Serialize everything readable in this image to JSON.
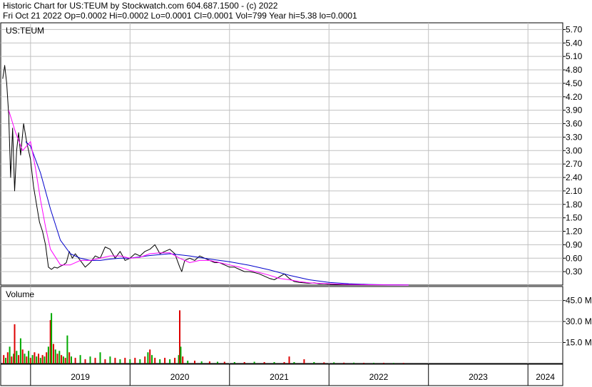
{
  "header": {
    "line1": "Historic Chart for US:TEUM by Stockwatch.com 604.687.1500 - (c) 2022",
    "line2": "Fri Oct 21 2022   Op=0.0002   Hi=0.0002   Lo=0.0001   Cl=0.0001   Vol=799   Year hi=5.38   lo=0.0001"
  },
  "colors": {
    "price": "#000000",
    "ma_fast": "#ff00ff",
    "ma_slow": "#0000cc",
    "vol_up": "#00aa00",
    "vol_down": "#dd0000",
    "grid": "#c0c0c0"
  },
  "chart_data": [
    {
      "type": "line",
      "title": "US:TEUM",
      "ylim": [
        0,
        5.85
      ],
      "yticks": [
        "5.70",
        "5.40",
        "5.10",
        "4.80",
        "4.50",
        "4.20",
        "3.90",
        "3.60",
        "3.30",
        "3.00",
        "2.70",
        "2.40",
        "2.10",
        "1.80",
        "1.50",
        "1.20",
        "0.90",
        "0.60",
        "0.30"
      ],
      "yticks_values": [
        5.7,
        5.4,
        5.1,
        4.8,
        4.5,
        4.2,
        3.9,
        3.6,
        3.3,
        3.0,
        2.7,
        2.4,
        2.1,
        1.8,
        1.5,
        1.2,
        0.9,
        0.6,
        0.3
      ],
      "x_years": [
        "2019",
        "2020",
        "2021",
        "2022",
        "2023",
        "2024"
      ],
      "x_year_starts": [
        2019.0,
        2020.0,
        2021.0,
        2022.0,
        2023.0,
        2024.0
      ],
      "x_range": [
        2018.7,
        2024.35
      ],
      "series": [
        {
          "key": "price",
          "x": [
            2018.72,
            2018.74,
            2018.76,
            2018.78,
            2018.8,
            2018.82,
            2018.84,
            2018.86,
            2018.88,
            2018.9,
            2018.93,
            2018.96,
            2019.0,
            2019.03,
            2019.06,
            2019.09,
            2019.12,
            2019.15,
            2019.18,
            2019.21,
            2019.24,
            2019.27,
            2019.3,
            2019.33,
            2019.36,
            2019.39,
            2019.42,
            2019.45,
            2019.5,
            2019.55,
            2019.6,
            2019.65,
            2019.7,
            2019.75,
            2019.8,
            2019.85,
            2019.9,
            2019.95,
            2020.0,
            2020.05,
            2020.1,
            2020.15,
            2020.2,
            2020.25,
            2020.3,
            2020.35,
            2020.4,
            2020.45,
            2020.5,
            2020.52,
            2020.55,
            2020.6,
            2020.65,
            2020.7,
            2020.75,
            2020.8,
            2020.85,
            2020.9,
            2020.95,
            2021.0,
            2021.05,
            2021.1,
            2021.15,
            2021.2,
            2021.25,
            2021.3,
            2021.35,
            2021.4,
            2021.45,
            2021.5,
            2021.55,
            2021.6,
            2021.65,
            2021.7,
            2021.75,
            2021.8,
            2021.85,
            2021.9,
            2021.95,
            2022.0,
            2022.1,
            2022.2,
            2022.3,
            2022.4,
            2022.5,
            2022.6,
            2022.7,
            2022.8
          ],
          "values": [
            4.6,
            4.9,
            4.5,
            3.8,
            2.4,
            3.5,
            2.1,
            3.0,
            3.4,
            2.9,
            3.6,
            3.2,
            2.8,
            2.2,
            1.8,
            1.4,
            1.2,
            0.9,
            0.4,
            0.35,
            0.4,
            0.38,
            0.42,
            0.45,
            0.5,
            0.75,
            0.6,
            0.7,
            0.55,
            0.4,
            0.5,
            0.65,
            0.6,
            0.85,
            0.8,
            0.6,
            0.75,
            0.55,
            0.6,
            0.7,
            0.65,
            0.75,
            0.8,
            0.9,
            0.7,
            0.75,
            0.8,
            0.7,
            0.4,
            0.3,
            0.55,
            0.6,
            0.55,
            0.65,
            0.6,
            0.55,
            0.5,
            0.5,
            0.45,
            0.4,
            0.4,
            0.35,
            0.3,
            0.3,
            0.28,
            0.25,
            0.2,
            0.15,
            0.12,
            0.18,
            0.25,
            0.15,
            0.08,
            0.06,
            0.05,
            0.04,
            0.05,
            0.03,
            0.03,
            0.02,
            0.015,
            0.012,
            0.01,
            0.008,
            0.006,
            0.004,
            0.003,
            0.002
          ]
        },
        {
          "key": "ma_fast",
          "x": [
            2018.78,
            2018.85,
            2018.92,
            2019.0,
            2019.05,
            2019.1,
            2019.15,
            2019.2,
            2019.3,
            2019.4,
            2019.5,
            2019.6,
            2019.7,
            2019.8,
            2019.9,
            2020.0,
            2020.1,
            2020.2,
            2020.3,
            2020.4,
            2020.5,
            2020.6,
            2020.7,
            2020.8,
            2020.9,
            2021.0,
            2021.1,
            2021.2,
            2021.3,
            2021.4,
            2021.5,
            2021.6,
            2021.7,
            2021.8,
            2021.9,
            2022.0,
            2022.2,
            2022.4,
            2022.6,
            2022.8
          ],
          "values": [
            3.9,
            3.4,
            3.0,
            3.2,
            2.6,
            1.9,
            1.3,
            0.8,
            0.45,
            0.45,
            0.55,
            0.55,
            0.6,
            0.65,
            0.65,
            0.6,
            0.62,
            0.7,
            0.72,
            0.72,
            0.6,
            0.5,
            0.55,
            0.55,
            0.5,
            0.45,
            0.4,
            0.33,
            0.28,
            0.22,
            0.15,
            0.12,
            0.08,
            0.05,
            0.04,
            0.03,
            0.015,
            0.008,
            0.004,
            0.002
          ]
        },
        {
          "key": "ma_slow",
          "x": [
            2018.95,
            2019.0,
            2019.1,
            2019.2,
            2019.3,
            2019.4,
            2019.5,
            2019.6,
            2019.7,
            2019.8,
            2019.9,
            2020.0,
            2020.2,
            2020.4,
            2020.6,
            2020.8,
            2021.0,
            2021.2,
            2021.4,
            2021.6,
            2021.8,
            2022.0,
            2022.2,
            2022.4,
            2022.6,
            2022.8
          ],
          "values": [
            3.2,
            3.1,
            2.5,
            1.7,
            1.0,
            0.7,
            0.6,
            0.55,
            0.55,
            0.58,
            0.6,
            0.6,
            0.66,
            0.7,
            0.65,
            0.58,
            0.52,
            0.44,
            0.34,
            0.22,
            0.12,
            0.06,
            0.03,
            0.015,
            0.007,
            0.003
          ]
        }
      ]
    },
    {
      "type": "bar",
      "title": "Volume",
      "ylim": [
        0,
        55
      ],
      "yticks": [
        "45.0 M",
        "30.0 M",
        "15.0 M"
      ],
      "yticks_values": [
        45,
        30,
        15
      ],
      "bars": [
        {
          "x": 2018.73,
          "v": 6,
          "up": false
        },
        {
          "x": 2018.75,
          "v": 4,
          "up": true
        },
        {
          "x": 2018.77,
          "v": 8,
          "up": false
        },
        {
          "x": 2018.79,
          "v": 12,
          "up": true
        },
        {
          "x": 2018.81,
          "v": 5,
          "up": false
        },
        {
          "x": 2018.83,
          "v": 7,
          "up": true
        },
        {
          "x": 2018.84,
          "v": 28,
          "up": false
        },
        {
          "x": 2018.86,
          "v": 9,
          "up": true
        },
        {
          "x": 2018.88,
          "v": 6,
          "up": false
        },
        {
          "x": 2018.9,
          "v": 18,
          "up": true
        },
        {
          "x": 2018.92,
          "v": 10,
          "up": false
        },
        {
          "x": 2018.94,
          "v": 7,
          "up": true
        },
        {
          "x": 2018.96,
          "v": 5,
          "up": false
        },
        {
          "x": 2018.98,
          "v": 9,
          "up": true
        },
        {
          "x": 2019.0,
          "v": 4,
          "up": false
        },
        {
          "x": 2019.02,
          "v": 6,
          "up": true
        },
        {
          "x": 2019.04,
          "v": 8,
          "up": false
        },
        {
          "x": 2019.06,
          "v": 5,
          "up": true
        },
        {
          "x": 2019.08,
          "v": 7,
          "up": false
        },
        {
          "x": 2019.1,
          "v": 4,
          "up": true
        },
        {
          "x": 2019.12,
          "v": 6,
          "up": false
        },
        {
          "x": 2019.14,
          "v": 5,
          "up": true
        },
        {
          "x": 2019.16,
          "v": 8,
          "up": false
        },
        {
          "x": 2019.18,
          "v": 12,
          "up": true
        },
        {
          "x": 2019.2,
          "v": 31,
          "up": false
        },
        {
          "x": 2019.21,
          "v": 36,
          "up": true
        },
        {
          "x": 2019.23,
          "v": 14,
          "up": false
        },
        {
          "x": 2019.25,
          "v": 10,
          "up": true
        },
        {
          "x": 2019.27,
          "v": 7,
          "up": false
        },
        {
          "x": 2019.29,
          "v": 9,
          "up": true
        },
        {
          "x": 2019.31,
          "v": 6,
          "up": false
        },
        {
          "x": 2019.33,
          "v": 5,
          "up": true
        },
        {
          "x": 2019.35,
          "v": 4,
          "up": false
        },
        {
          "x": 2019.37,
          "v": 20,
          "up": true
        },
        {
          "x": 2019.39,
          "v": 8,
          "up": false
        },
        {
          "x": 2019.41,
          "v": 5,
          "up": true
        },
        {
          "x": 2019.45,
          "v": 4,
          "up": false
        },
        {
          "x": 2019.5,
          "v": 6,
          "up": true
        },
        {
          "x": 2019.55,
          "v": 3,
          "up": false
        },
        {
          "x": 2019.6,
          "v": 5,
          "up": true
        },
        {
          "x": 2019.65,
          "v": 4,
          "up": false
        },
        {
          "x": 2019.7,
          "v": 8,
          "up": true
        },
        {
          "x": 2019.75,
          "v": 3,
          "up": false
        },
        {
          "x": 2019.8,
          "v": 5,
          "up": true
        },
        {
          "x": 2019.85,
          "v": 4,
          "up": false
        },
        {
          "x": 2019.9,
          "v": 3,
          "up": true
        },
        {
          "x": 2019.95,
          "v": 4,
          "up": false
        },
        {
          "x": 2020.0,
          "v": 3,
          "up": true
        },
        {
          "x": 2020.05,
          "v": 4,
          "up": false
        },
        {
          "x": 2020.1,
          "v": 3,
          "up": true
        },
        {
          "x": 2020.15,
          "v": 5,
          "up": false
        },
        {
          "x": 2020.18,
          "v": 8,
          "up": true
        },
        {
          "x": 2020.2,
          "v": 10,
          "up": false
        },
        {
          "x": 2020.22,
          "v": 6,
          "up": true
        },
        {
          "x": 2020.25,
          "v": 4,
          "up": false
        },
        {
          "x": 2020.3,
          "v": 3,
          "up": true
        },
        {
          "x": 2020.35,
          "v": 4,
          "up": false
        },
        {
          "x": 2020.4,
          "v": 3,
          "up": true
        },
        {
          "x": 2020.45,
          "v": 4,
          "up": false
        },
        {
          "x": 2020.49,
          "v": 6,
          "up": true
        },
        {
          "x": 2020.5,
          "v": 38,
          "up": false
        },
        {
          "x": 2020.51,
          "v": 12,
          "up": true
        },
        {
          "x": 2020.53,
          "v": 5,
          "up": false
        },
        {
          "x": 2020.58,
          "v": 2,
          "up": true
        },
        {
          "x": 2020.65,
          "v": 2,
          "up": false
        },
        {
          "x": 2020.72,
          "v": 1.5,
          "up": true
        },
        {
          "x": 2020.8,
          "v": 1.5,
          "up": false
        },
        {
          "x": 2020.88,
          "v": 1.2,
          "up": true
        },
        {
          "x": 2020.95,
          "v": 1.2,
          "up": false
        },
        {
          "x": 2021.05,
          "v": 1,
          "up": true
        },
        {
          "x": 2021.15,
          "v": 1,
          "up": false
        },
        {
          "x": 2021.25,
          "v": 1.2,
          "up": true
        },
        {
          "x": 2021.35,
          "v": 1,
          "up": false
        },
        {
          "x": 2021.45,
          "v": 1,
          "up": true
        },
        {
          "x": 2021.55,
          "v": 1,
          "up": false
        },
        {
          "x": 2021.6,
          "v": 5,
          "up": false
        },
        {
          "x": 2021.65,
          "v": 1,
          "up": true
        },
        {
          "x": 2021.75,
          "v": 3,
          "up": false
        },
        {
          "x": 2021.85,
          "v": 1,
          "up": true
        },
        {
          "x": 2021.95,
          "v": 0.8,
          "up": false
        },
        {
          "x": 2022.05,
          "v": 0.8,
          "up": true
        },
        {
          "x": 2022.15,
          "v": 0.6,
          "up": false
        },
        {
          "x": 2022.25,
          "v": 0.6,
          "up": true
        },
        {
          "x": 2022.35,
          "v": 0.5,
          "up": false
        },
        {
          "x": 2022.45,
          "v": 0.5,
          "up": true
        },
        {
          "x": 2022.55,
          "v": 0.5,
          "up": false
        },
        {
          "x": 2022.65,
          "v": 0.4,
          "up": true
        },
        {
          "x": 2022.75,
          "v": 0.4,
          "up": false
        }
      ]
    }
  ]
}
